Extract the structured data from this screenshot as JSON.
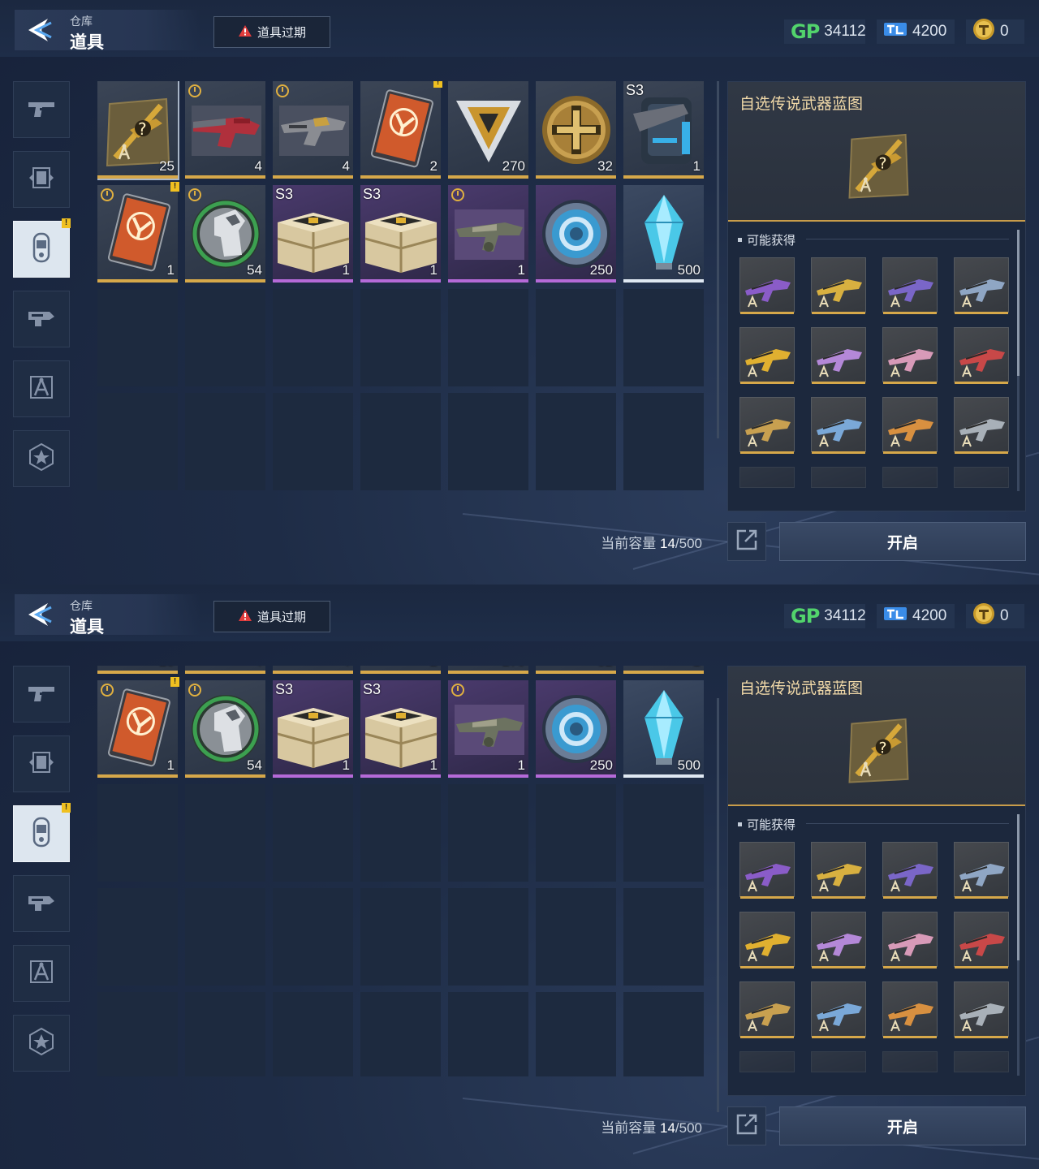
{
  "header": {
    "crumb_parent": "仓库",
    "crumb_title": "道具",
    "expire_label": "道具过期",
    "currencies": [
      {
        "name": "gp",
        "label": "GP",
        "value": "34112"
      },
      {
        "name": "ticket",
        "value": "4200"
      },
      {
        "name": "token",
        "value": "0"
      }
    ]
  },
  "tabs": [
    {
      "name": "weapons",
      "icon": "pistol-icon"
    },
    {
      "name": "frames",
      "icon": "frame-icon"
    },
    {
      "name": "items",
      "icon": "capsule-icon",
      "active": true,
      "badge": "!"
    },
    {
      "name": "attachments",
      "icon": "attachment-icon"
    },
    {
      "name": "blueprints",
      "icon": "blueprint-icon"
    },
    {
      "name": "badges",
      "icon": "star-badge-icon"
    }
  ],
  "items_row1": [
    {
      "name": "legend-blueprint-chest",
      "qty": "25",
      "rarity": "gold",
      "selected": true
    },
    {
      "name": "red-rifle",
      "qty": "4",
      "rarity": "gold",
      "timer": true
    },
    {
      "name": "gray-smg",
      "qty": "4",
      "rarity": "gold",
      "timer": true
    },
    {
      "name": "rename-card",
      "qty": "2",
      "rarity": "gold",
      "badge": "!"
    },
    {
      "name": "triangle-emblem",
      "qty": "270",
      "rarity": "gold"
    },
    {
      "name": "gold-coin",
      "qty": "32",
      "rarity": "gold"
    },
    {
      "name": "s3-backpack",
      "qty": "1",
      "rarity": "gold",
      "tag": "S3"
    }
  ],
  "items_row2": [
    {
      "name": "rename-card-timed",
      "qty": "1",
      "rarity": "gold",
      "timer": true,
      "badge": "!"
    },
    {
      "name": "horse-medal",
      "qty": "54",
      "rarity": "gold",
      "timer": true
    },
    {
      "name": "s3-supply-box",
      "qty": "1",
      "rarity": "purple",
      "tag": "S3"
    },
    {
      "name": "s3-supply-box-2",
      "qty": "1",
      "rarity": "purple",
      "tag": "S3"
    },
    {
      "name": "camo-rifle",
      "qty": "1",
      "rarity": "purple",
      "timer": true
    },
    {
      "name": "blue-coin",
      "qty": "250",
      "rarity": "purple"
    },
    {
      "name": "crystal",
      "qty": "500",
      "rarity": "white"
    }
  ],
  "capacity": {
    "label": "当前容量",
    "current": "14",
    "max": "/500"
  },
  "detail": {
    "title": "自选传说武器蓝图",
    "possible_label": "可能获得",
    "rewards": [
      {
        "name": "purple-rifle",
        "color": "#8a5cc8"
      },
      {
        "name": "gold-black-rifle",
        "color": "#d8b040"
      },
      {
        "name": "purple-sniper",
        "color": "#7a66c8"
      },
      {
        "name": "camo-smg",
        "color": "#8fa6c4"
      },
      {
        "name": "gold-smg",
        "color": "#e0b030"
      },
      {
        "name": "pink-rifle",
        "color": "#b488d8"
      },
      {
        "name": "pink-lmg",
        "color": "#d89ab8"
      },
      {
        "name": "red-rifle",
        "color": "#c84848"
      },
      {
        "name": "gold-pistol",
        "color": "#c8a050"
      },
      {
        "name": "blue-smg",
        "color": "#7aa8d8"
      },
      {
        "name": "orange-rifle",
        "color": "#d89040"
      },
      {
        "name": "silver-rifle",
        "color": "#a8b0b8"
      }
    ],
    "open_label": "开启"
  }
}
